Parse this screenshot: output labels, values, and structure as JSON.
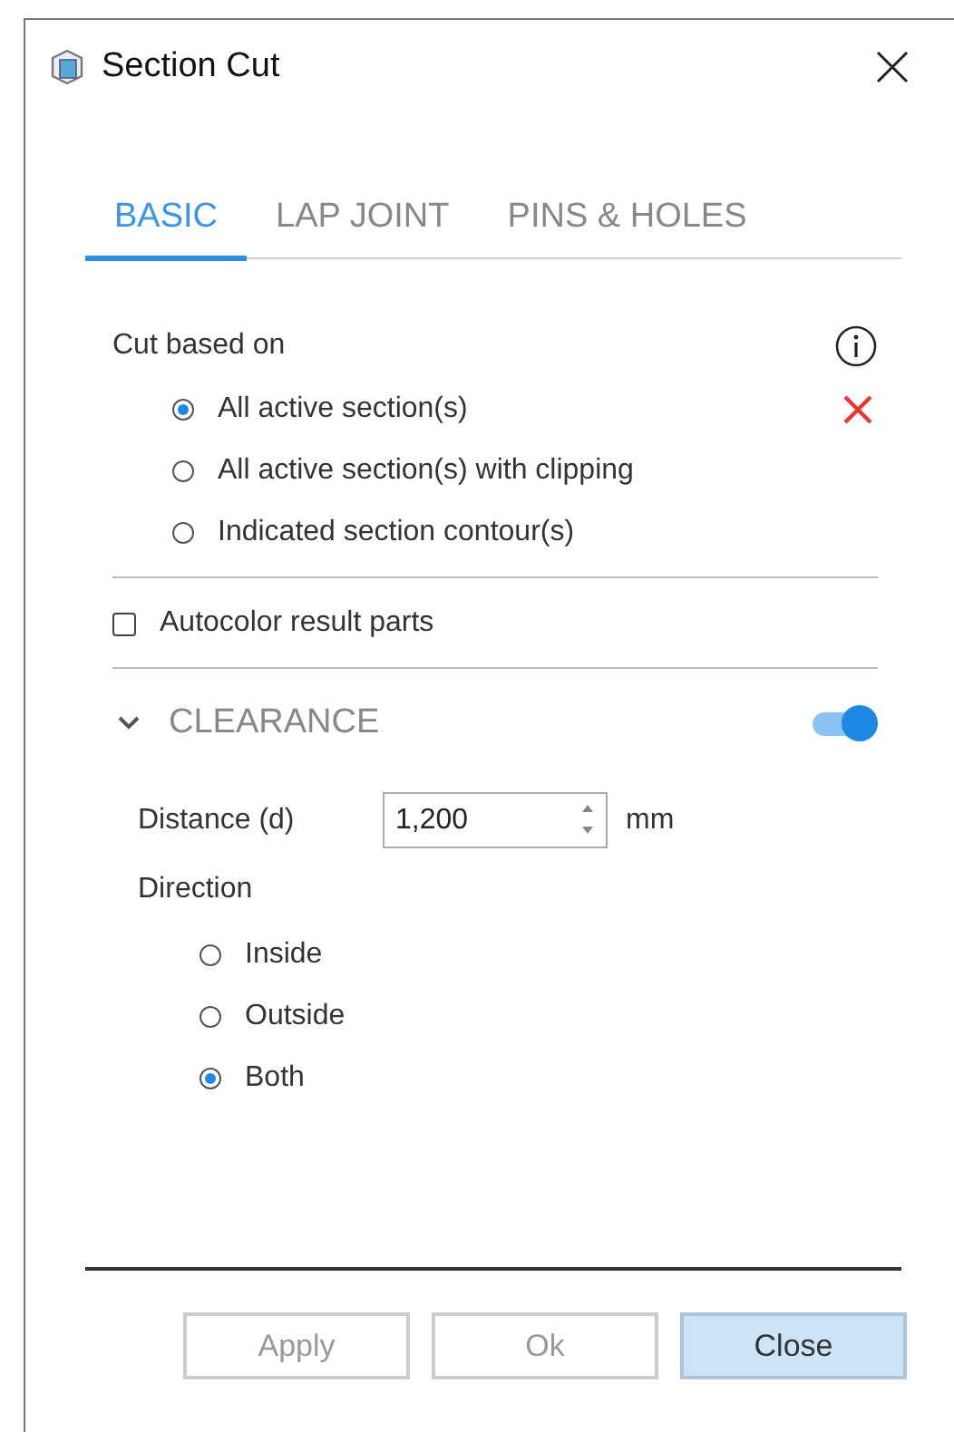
{
  "window": {
    "title": "Section Cut"
  },
  "tabs": [
    {
      "label": "BASIC",
      "selected": true
    },
    {
      "label": "LAP JOINT",
      "selected": false
    },
    {
      "label": "PINS & HOLES",
      "selected": false
    }
  ],
  "cut_based_on": {
    "label": "Cut based on",
    "options": [
      {
        "label": "All active section(s)",
        "selected": true
      },
      {
        "label": "All active section(s) with clipping",
        "selected": false
      },
      {
        "label": "Indicated section contour(s)",
        "selected": false
      }
    ]
  },
  "autocolor": {
    "label": "Autocolor result parts",
    "checked": false
  },
  "clearance": {
    "title": "CLEARANCE",
    "expanded": true,
    "on": true,
    "distance": {
      "label": "Distance (d)",
      "value": "1,200",
      "unit": "mm"
    },
    "direction": {
      "label": "Direction",
      "options": [
        {
          "label": "Inside",
          "selected": false
        },
        {
          "label": "Outside",
          "selected": false
        },
        {
          "label": "Both",
          "selected": true
        }
      ]
    }
  },
  "buttons": [
    {
      "label": "Apply",
      "disabled": true,
      "highlighted": false
    },
    {
      "label": "Ok",
      "disabled": true,
      "highlighted": false
    },
    {
      "label": "Close",
      "disabled": false,
      "highlighted": true
    }
  ]
}
